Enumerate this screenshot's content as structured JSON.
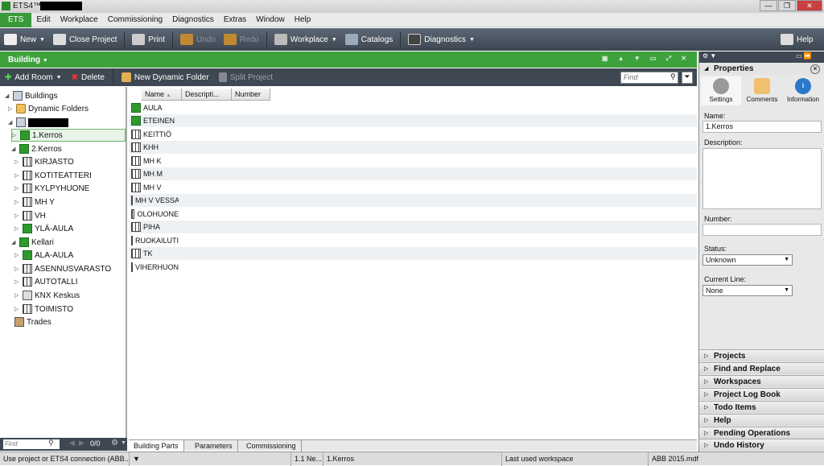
{
  "titlebar": {
    "app_name": "ETS4™ -"
  },
  "menubar": {
    "items": [
      "ETS",
      "Edit",
      "Workplace",
      "Commissioning",
      "Diagnostics",
      "Extras",
      "Window",
      "Help"
    ]
  },
  "toolbar": {
    "new": "New",
    "close_project": "Close Project",
    "print": "Print",
    "undo": "Undo",
    "redo": "Redo",
    "workplace": "Workplace",
    "catalogs": "Catalogs",
    "diagnostics": "Diagnostics",
    "help": "Help"
  },
  "panel": {
    "title": "Building"
  },
  "actions": {
    "add_room": "Add Room",
    "delete": "Delete",
    "new_dynamic_folder": "New Dynamic Folder",
    "split_project": "Split Project",
    "find_placeholder": "Find"
  },
  "tree": {
    "nodes": [
      {
        "label": "Buildings"
      },
      {
        "label": "Dynamic Folders"
      },
      {
        "label": ""
      },
      {
        "label": "1.Kerros"
      },
      {
        "label": "2.Kerros"
      },
      {
        "label": "KIRJASTO"
      },
      {
        "label": "KOTITEATTERI"
      },
      {
        "label": "KYLPYHUONE"
      },
      {
        "label": "MH Y"
      },
      {
        "label": "VH"
      },
      {
        "label": "YLÄ-AULA"
      },
      {
        "label": "Kellari"
      },
      {
        "label": "ALA-AULA"
      },
      {
        "label": "ASENNUSVARASTO"
      },
      {
        "label": "AUTOTALLI"
      },
      {
        "label": "KNX Keskus"
      },
      {
        "label": "TOIMISTO"
      },
      {
        "label": "Trades"
      }
    ],
    "find_placeholder": "Find",
    "count": "0/0"
  },
  "grid": {
    "columns": [
      "Name",
      "Descripti...",
      "Number"
    ],
    "rows": [
      "AULA",
      "ETEINEN",
      "KEITTIÖ",
      "KHH",
      "MH K",
      "MH M",
      "MH V",
      "MH V VESSA",
      "OLOHUONE",
      "PIHA",
      "RUOKAILUTILA",
      "TK",
      "VIHERHUONE"
    ]
  },
  "tabs": [
    "Building Parts",
    "Parameters",
    "Commissioning"
  ],
  "statusbar": {
    "connection": "Use project or ETS4 connection (ABB...",
    "address": "1.1 Ne...",
    "location": "1.Kerros",
    "workspace": "Last used workspace",
    "database": "ABB 2015.mdf"
  },
  "properties": {
    "title": "Properties",
    "tabs": [
      "Settings",
      "Comments",
      "Information"
    ],
    "name_label": "Name:",
    "name_value": "1.Kerros",
    "description_label": "Description:",
    "number_label": "Number:",
    "status_label": "Status:",
    "status_value": "Unknown",
    "current_line_label": "Current Line:",
    "current_line_value": "None",
    "sections": [
      "Projects",
      "Find and Replace",
      "Workspaces",
      "Project Log Book",
      "Todo Items",
      "Help",
      "Pending Operations",
      "Undo History"
    ]
  }
}
